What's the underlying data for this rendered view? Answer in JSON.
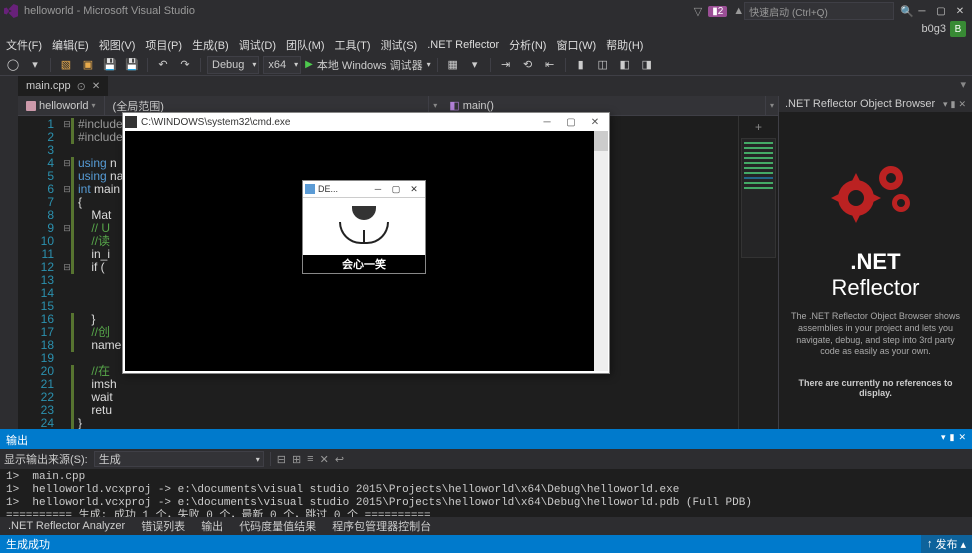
{
  "title": "helloworld - Microsoft Visual Studio",
  "notif_count": "2",
  "search_placeholder": "快速启动 (Ctrl+Q)",
  "user": "b0g3",
  "avatar": "B",
  "menu": [
    "文件(F)",
    "编辑(E)",
    "视图(V)",
    "项目(P)",
    "生成(B)",
    "调试(D)",
    "团队(M)",
    "工具(T)",
    "测试(S)",
    ".NET Reflector",
    "分析(N)",
    "窗口(W)",
    "帮助(H)"
  ],
  "toolbar": {
    "config": "Debug",
    "platform": "x64",
    "start": "本地 Windows 调试器"
  },
  "tab": {
    "name": "main.cpp"
  },
  "nav": {
    "project": "helloworld",
    "scope": "(全局范围)",
    "func": "main()"
  },
  "code_lines": [
    "#include <opencv2/opencv.hpp>",
    "#include <iostream>",
    "",
    "using n",
    "using na",
    "int main",
    "{",
    "    Mat",
    "    // U",
    "    //读",
    "    in_i",
    "    if (",
    "",
    "",
    "",
    "    }",
    "    //创",
    "    name",
    "",
    "    //在",
    "    imsh",
    "    wait",
    "    retu",
    "}"
  ],
  "right_panel": {
    "title": ".NET Reflector Object Browser",
    "brand_pre": ".NET",
    "brand_post": "Reflector",
    "desc": "The .NET Reflector Object Browser shows assemblies in your project and lets you navigate, debug, and step into 3rd party code as easily as your own.",
    "noref": "There are currently no references to display."
  },
  "output": {
    "title": "输出",
    "source_label": "显示输出来源(S):",
    "source": "生成",
    "lines": [
      "1>  main.cpp",
      "1>  helloworld.vcxproj -> e:\\documents\\visual studio 2015\\Projects\\helloworld\\x64\\Debug\\helloworld.exe",
      "1>  helloworld.vcxproj -> e:\\documents\\visual studio 2015\\Projects\\helloworld\\x64\\Debug\\helloworld.pdb (Full PDB)",
      "========== 生成: 成功 1 个，失败 0 个，最新 0 个，跳过 0 个 =========="
    ]
  },
  "bottom_tabs": [
    ".NET Reflector Analyzer",
    "错误列表",
    "输出",
    "代码度量值结果",
    "程序包管理器控制台"
  ],
  "status": {
    "left": "生成成功",
    "publish": "发布"
  },
  "cmd": {
    "title": "C:\\WINDOWS\\system32\\cmd.exe"
  },
  "imgwin": {
    "title": "DE...",
    "caption": "会心一笑"
  }
}
